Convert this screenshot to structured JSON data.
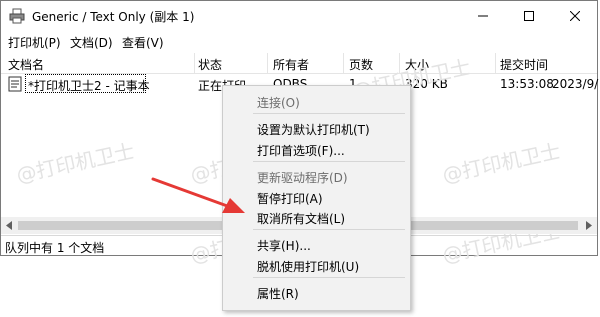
{
  "window": {
    "title": "Generic / Text Only (副本 1)",
    "controls": {
      "minimize": "—",
      "maximize": "☐",
      "close": "✕"
    }
  },
  "menubar": {
    "items": [
      {
        "label": "打印机(P)"
      },
      {
        "label": "文档(D)"
      },
      {
        "label": "查看(V)"
      }
    ]
  },
  "columns": {
    "docname": "文档名",
    "status": "状态",
    "owner": "所有者",
    "pages": "页数",
    "size": "大小",
    "submitted": "提交时间"
  },
  "jobs": [
    {
      "docname": "*打印机卫士2 - 记事本",
      "status": "正在打印",
      "owner": "ODBS",
      "pages": "1",
      "size": "320 KB",
      "time": "13:53:08",
      "date": "2023/9/"
    }
  ],
  "statusbar": {
    "text": "队列中有 1 个文档"
  },
  "watermark": {
    "text": "@打印机卫士"
  },
  "context_menu": {
    "items": [
      {
        "label": "连接(O)",
        "disabled": true
      },
      {
        "label": "设置为默认打印机(T)",
        "disabled": false
      },
      {
        "label": "打印首选项(F)...",
        "disabled": false
      },
      {
        "label": "更新驱动程序(D)",
        "disabled": true
      },
      {
        "label": "暂停打印(A)",
        "disabled": false
      },
      {
        "label": "取消所有文档(L)",
        "disabled": false
      },
      {
        "label": "共享(H)...",
        "disabled": false
      },
      {
        "label": "脱机使用打印机(U)",
        "disabled": false
      },
      {
        "label": "属性(R)",
        "disabled": false
      }
    ]
  },
  "colors": {
    "arrow": "#e53935",
    "menu_bg": "#f2f2f2"
  },
  "icons": [
    "printer-icon",
    "document-icon",
    "annotation-arrow"
  ]
}
